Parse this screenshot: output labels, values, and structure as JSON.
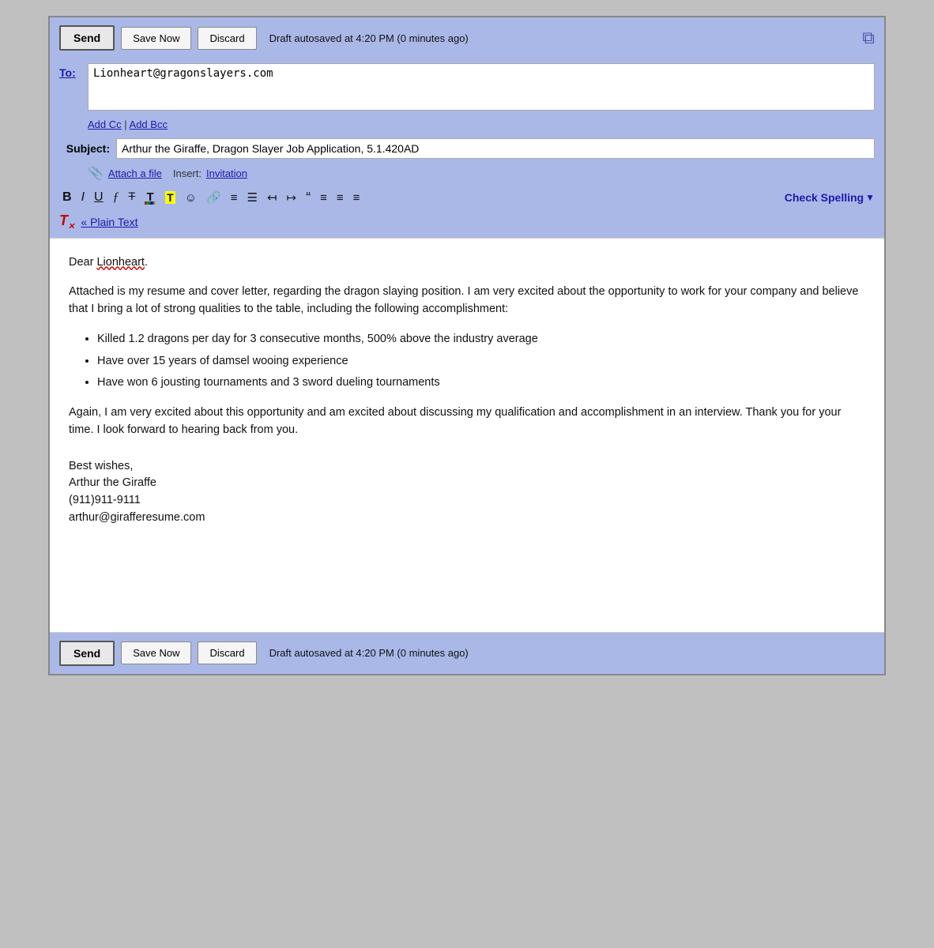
{
  "toolbar": {
    "send_label": "Send",
    "save_now_label": "Save Now",
    "discard_label": "Discard",
    "autosave_text": "Draft autosaved at 4:20 PM (0 minutes ago)",
    "check_spelling_label": "Check Spelling"
  },
  "to_field": {
    "label": "To:",
    "value": "Lionheart@gragonslayers.com"
  },
  "cc_bcc": {
    "add_cc": "Add Cc",
    "separator": " | ",
    "add_bcc": "Add Bcc"
  },
  "subject": {
    "label": "Subject:",
    "value": "Arthur the Giraffe, Dragon Slayer Job Application, 5.1.420AD"
  },
  "attach": {
    "icon": "📎",
    "link": "Attach a file",
    "insert_label": "Insert:",
    "insert_link": "Invitation"
  },
  "formatting": {
    "bold": "B",
    "italic": "I",
    "underline": "U",
    "font": "𝒻",
    "strikethrough": "T̶",
    "sub_t": "T",
    "emoji": "☺",
    "link": "🔗",
    "ordered_list": "≡",
    "unordered_list": "☰",
    "indent_less": "⇤",
    "indent_more": "⇥",
    "blockquote": "❝",
    "align_left": "≡",
    "align_center": "≡",
    "align_right": "≡",
    "plain_text_arrow": "«",
    "plain_text_label": "Plain Text",
    "check_spelling": "Check Spelling",
    "dropdown_arrow": "▼"
  },
  "body": {
    "salutation": "Dear Lionheart,",
    "para1": "Attached is my resume and cover letter, regarding the dragon slaying position.  I am very excited about the opportunity to work for your company and believe that I bring a lot of strong qualities to the table, including the following accomplishment:",
    "bullets": [
      "Killed 1.2 dragons per day for 3 consecutive months, 500% above the industry average",
      "Have over 15 years of damsel wooing experience",
      "Have won 6 jousting tournaments and 3 sword dueling tournaments"
    ],
    "para2": "Again, I am very excited about this opportunity and am excited about discussing my qualification and accomplishment in an interview.  Thank you for your time.  I look forward to hearing back from you.",
    "signature_line1": "Best wishes,",
    "signature_line2": "Arthur the Giraffe",
    "signature_line3": "(911)911-9111",
    "signature_line4": "arthur@girafferesume.com"
  },
  "bottom_toolbar": {
    "send_label": "Send",
    "save_now_label": "Save Now",
    "discard_label": "Discard",
    "autosave_text": "Draft autosaved at 4:20 PM (0 minutes ago)"
  }
}
